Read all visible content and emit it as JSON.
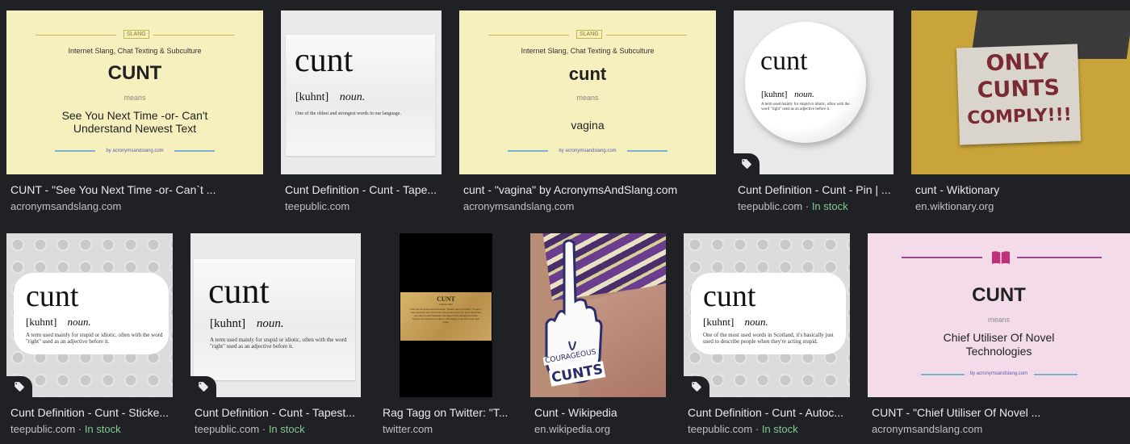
{
  "results": [
    {
      "title": "CUNT - \"See You Next Time -or- Can`t ...",
      "source": "acronymsandslang.com",
      "stock": "",
      "thumb": {
        "category": "Internet Slang, Chat Texting & Subculture",
        "badge": "SLANG",
        "word": "CUNT",
        "means": "means",
        "meaning": "See You Next Time -or- Can't Understand Newest Text",
        "footer": "by acronymsandslang.com"
      }
    },
    {
      "title": "Cunt Definition - Cunt - Tape...",
      "source": "teepublic.com",
      "stock": "",
      "thumb": {
        "word": "cunt",
        "phonetic": "[kuhnt]",
        "pos": "noun.",
        "definition": "One of the oldest and strongest words in our language."
      }
    },
    {
      "title": "cunt - \"vagina\" by AcronymsAndSlang.com",
      "source": "acronymsandslang.com",
      "stock": "",
      "thumb": {
        "category": "Internet Slang, Chat Texting & Subculture",
        "badge": "SLANG",
        "word": "cunt",
        "means": "means",
        "meaning": "vagina",
        "footer": "by acronymsandslang.com"
      }
    },
    {
      "title": "Cunt Definition - Cunt - Pin | ...",
      "source": "teepublic.com",
      "stock": "In stock",
      "thumb": {
        "word": "cunt",
        "phonetic": "[kuhnt]",
        "pos": "noun.",
        "definition": "A term used mainly for stupid or idiotic, often with the word \"right\" used as an adjective before it."
      }
    },
    {
      "title": "cunt - Wiktionary",
      "source": "en.wiktionary.org",
      "stock": "",
      "thumb": {
        "sign_lines": [
          "ONLY",
          "CUNTS",
          "COMPLY!!!"
        ]
      }
    },
    {
      "title": "Cunt Definition - Cunt - Sticke...",
      "source": "teepublic.com",
      "stock": "In stock",
      "thumb": {
        "word": "cunt",
        "phonetic": "[kuhnt]",
        "pos": "noun.",
        "definition": "A term used mainly for stupid or idiotic, often with the word \"right\" used as an adjective before it."
      }
    },
    {
      "title": "Cunt Definition - Cunt - Tapest...",
      "source": "teepublic.com",
      "stock": "In stock",
      "thumb": {
        "word": "cunt",
        "phonetic": "[kuhnt]",
        "pos": "noun.",
        "definition": "A term used mainly for stupid or idiotic, often with the word \"right\" used as an adjective before it."
      }
    },
    {
      "title": "Rag Tagg on Twitter: \"T...",
      "source": "twitter.com",
      "stock": "",
      "thumb": {
        "heading": "CUNT",
        "since": "SINCE 1344",
        "text": "Cunt was an ancient term that meant \"faithful and loyal friend.\" To have a Cunt meant having a friend who always had your back, never abandoned you, and provided friendship and support even through hard times. Society encouraged each other to value being a Cunt above any other virtue."
      }
    },
    {
      "title": "Cunt - Wikipedia",
      "source": "en.wikipedia.org",
      "stock": "",
      "thumb": {
        "sticker_lines": [
          "COURAGEOUS",
          "CUNTS"
        ]
      }
    },
    {
      "title": "Cunt Definition - Cunt - Autoc...",
      "source": "teepublic.com",
      "stock": "In stock",
      "thumb": {
        "word": "cunt",
        "phonetic": "[kuhnt]",
        "pos": "noun.",
        "definition": "One of the most used words in Scotland, it's basically just used to describe people when they're acting stupid."
      }
    },
    {
      "title": "CUNT - \"Chief Utiliser Of Novel ...",
      "source": "acronymsandslang.com",
      "stock": "",
      "thumb": {
        "word": "CUNT",
        "means": "means",
        "meaning": "Chief Utiliser Of Novel Technologies",
        "footer": "by acronymsandslang.com"
      }
    }
  ],
  "separator": "·",
  "colors": {
    "background": "#202124",
    "stock": "#81c995",
    "text": "#e8eaed",
    "subtext": "#bdc1c6"
  }
}
